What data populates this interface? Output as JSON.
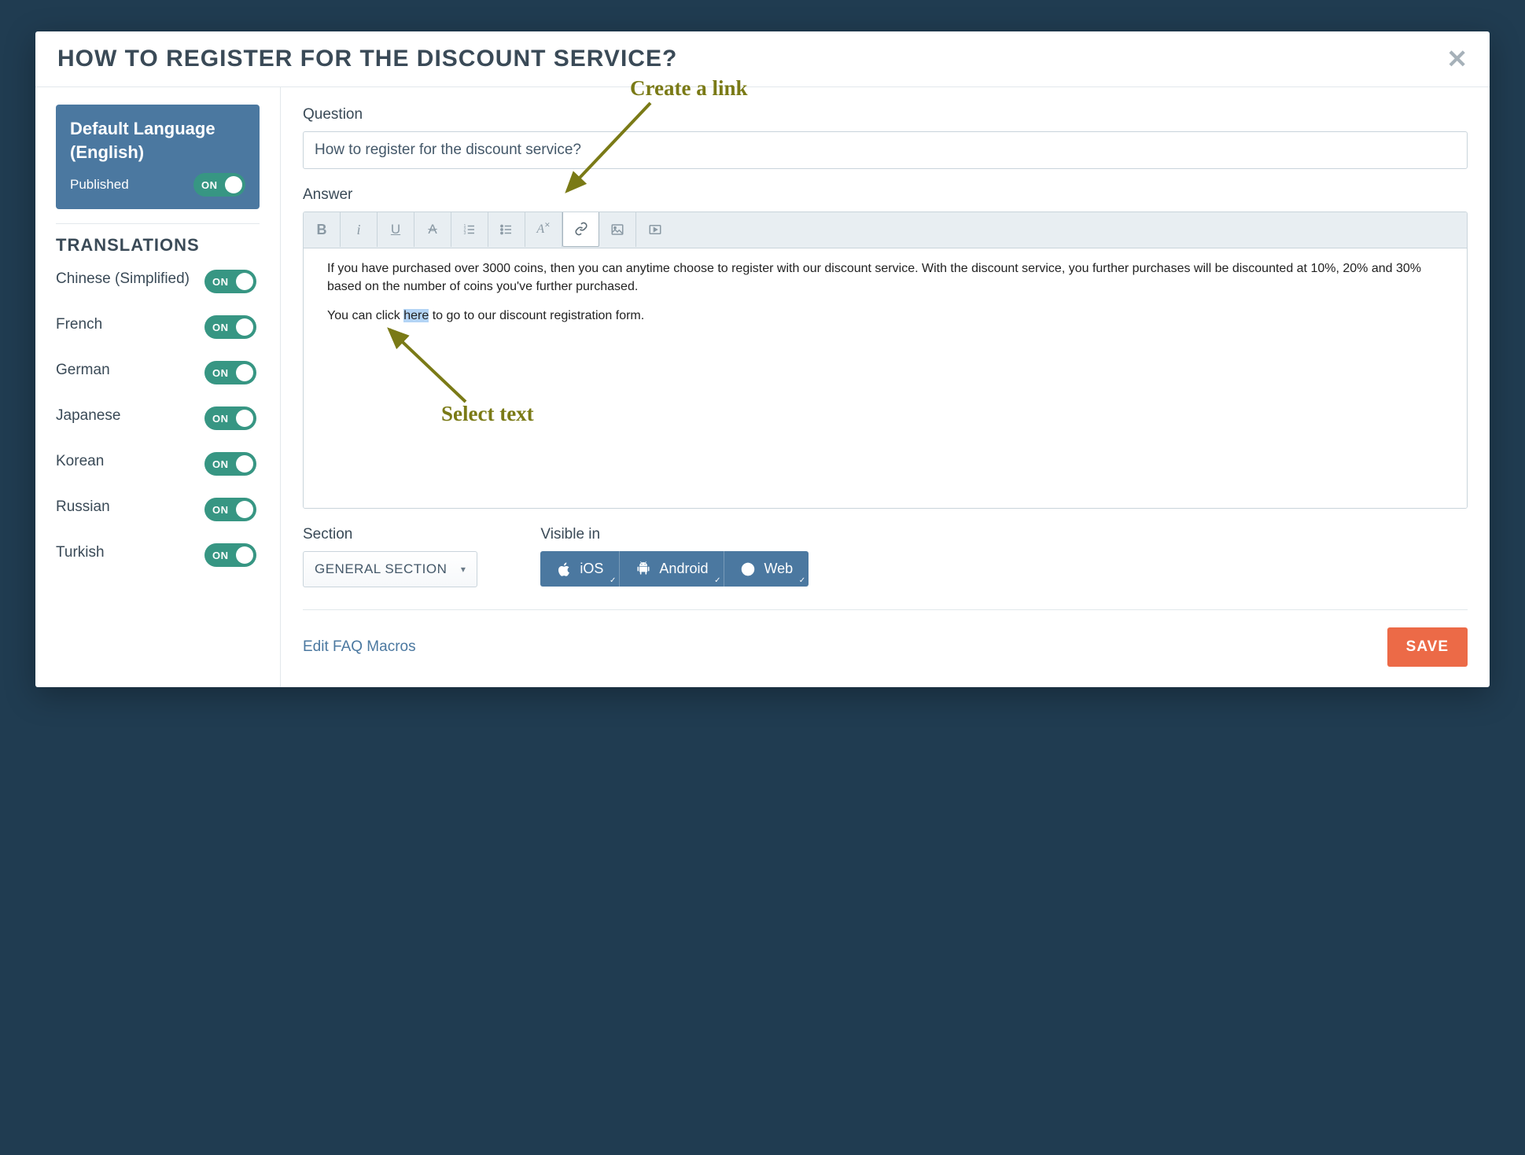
{
  "header": {
    "title": "HOW TO REGISTER FOR THE DISCOUNT SERVICE?"
  },
  "sidebar": {
    "default_language": {
      "title_line1": "Default Language",
      "title_line2": "(English)",
      "status": "Published",
      "toggle": "ON"
    },
    "translations_heading": "TRANSLATIONS",
    "languages": [
      {
        "name": "Chinese (Simplified)",
        "toggle": "ON"
      },
      {
        "name": "French",
        "toggle": "ON"
      },
      {
        "name": "German",
        "toggle": "ON"
      },
      {
        "name": "Japanese",
        "toggle": "ON"
      },
      {
        "name": "Korean",
        "toggle": "ON"
      },
      {
        "name": "Russian",
        "toggle": "ON"
      },
      {
        "name": "Turkish",
        "toggle": "ON"
      }
    ]
  },
  "main": {
    "question_label": "Question",
    "question_value": "How to register for the discount service?",
    "answer_label": "Answer",
    "answer_paragraph1": "If you have purchased over 3000 coins, then you can anytime choose to register with our discount service. With the discount service, you further purchases will be discounted at 10%, 20% and 30% based on the number of coins you've further purchased.",
    "answer_p2_prefix": "You can click ",
    "answer_p2_highlight": "here",
    "answer_p2_suffix": " to go to our discount registration form.",
    "section_label": "Section",
    "section_selected": "GENERAL SECTION",
    "visible_in_label": "Visible in",
    "platforms": [
      {
        "name": "iOS"
      },
      {
        "name": "Android"
      },
      {
        "name": "Web"
      }
    ],
    "macros_link": "Edit FAQ Macros",
    "save_button": "SAVE"
  },
  "annotations": {
    "create_link": "Create a link",
    "select_text": "Select text"
  }
}
